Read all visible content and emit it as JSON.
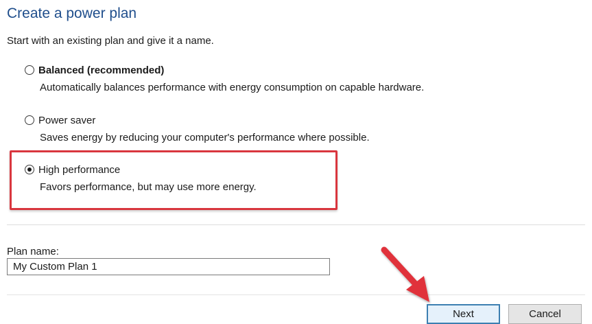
{
  "page": {
    "title": "Create a power plan",
    "subtitle": "Start with an existing plan and give it a name."
  },
  "options": [
    {
      "label": "Balanced (recommended)",
      "description": "Automatically balances performance with energy consumption on capable hardware.",
      "selected": false
    },
    {
      "label": "Power saver",
      "description": "Saves energy by reducing your computer's performance where possible.",
      "selected": false
    },
    {
      "label": "High performance",
      "description": "Favors performance, but may use more energy.",
      "selected": true
    }
  ],
  "plan_name": {
    "label": "Plan name:",
    "value": "My Custom Plan 1"
  },
  "buttons": {
    "next": "Next",
    "cancel": "Cancel"
  },
  "colors": {
    "title": "#1f4e8c",
    "highlight": "#d9363e",
    "arrow": "#e0313a",
    "primary_button_border": "#3c7fb1"
  },
  "icons": {
    "annotation_arrow": "red-arrow-icon"
  }
}
